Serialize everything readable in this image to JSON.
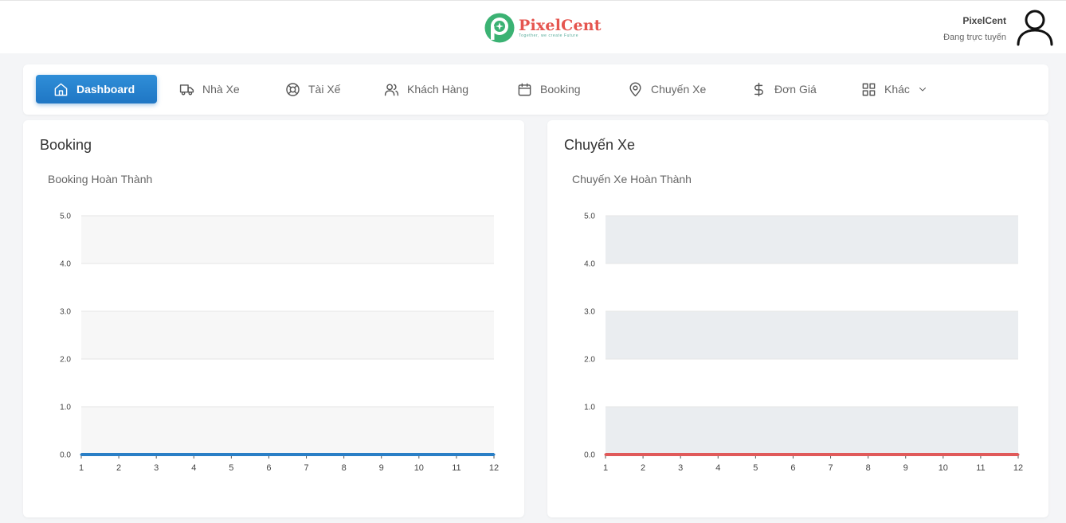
{
  "header": {
    "logo": {
      "name_part1": "Pixel",
      "name_part2": "Cent",
      "tagline": "Together, we create Future"
    },
    "user": {
      "name": "PixelCent",
      "status": "Đang trực tuyến"
    }
  },
  "nav": {
    "items": [
      {
        "label": "Dashboard",
        "icon": "home-icon",
        "active": true
      },
      {
        "label": "Nhà Xe",
        "icon": "truck-icon"
      },
      {
        "label": "Tài Xế",
        "icon": "steering-wheel-icon"
      },
      {
        "label": "Khách Hàng",
        "icon": "users-icon"
      },
      {
        "label": "Booking",
        "icon": "calendar-icon"
      },
      {
        "label": "Chuyến Xe",
        "icon": "map-pin-icon"
      },
      {
        "label": "Đơn Giá",
        "icon": "dollar-icon"
      },
      {
        "label": "Khác",
        "icon": "grid-icon",
        "dropdown": true
      }
    ]
  },
  "cards": {
    "booking": {
      "title": "Booking"
    },
    "trips": {
      "title": "Chuyến Xe"
    }
  },
  "chart_data": [
    {
      "type": "line",
      "title": "Booking Hoàn Thành",
      "x": [
        1,
        2,
        3,
        4,
        5,
        6,
        7,
        8,
        9,
        10,
        11,
        12
      ],
      "series": [
        {
          "values": [
            0,
            0,
            0,
            0,
            0,
            0,
            0,
            0,
            0,
            0,
            0,
            0
          ],
          "color": "#2a7fc6"
        }
      ],
      "yticks": [
        "0.0",
        "1.0",
        "2.0",
        "3.0",
        "4.0",
        "5.0"
      ],
      "ylim": [
        0,
        5
      ],
      "band_color": "#f7f7f7",
      "grid": true
    },
    {
      "type": "line",
      "title": "Chuyến Xe Hoàn Thành",
      "x": [
        1,
        2,
        3,
        4,
        5,
        6,
        7,
        8,
        9,
        10,
        11,
        12
      ],
      "series": [
        {
          "values": [
            0,
            0,
            0,
            0,
            0,
            0,
            0,
            0,
            0,
            0,
            0,
            0
          ],
          "color": "#e05a5a"
        }
      ],
      "yticks": [
        "0.0",
        "1.0",
        "2.0",
        "3.0",
        "4.0",
        "5.0"
      ],
      "ylim": [
        0,
        5
      ],
      "band_color": "#eaedf0",
      "grid": true
    }
  ]
}
